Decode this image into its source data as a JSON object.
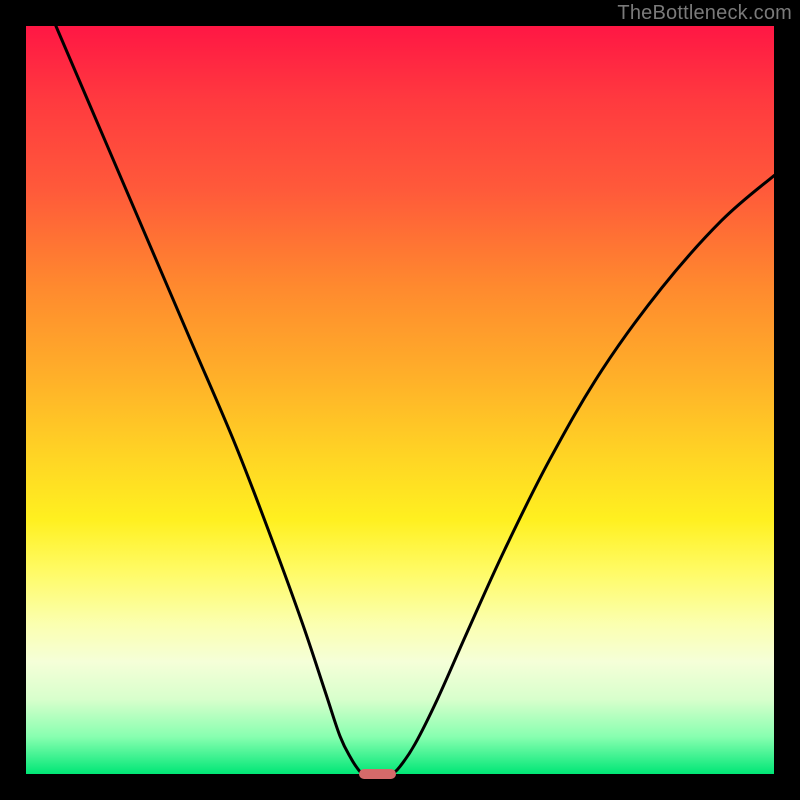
{
  "watermark": "TheBottleneck.com",
  "chart_data": {
    "type": "line",
    "title": "",
    "xlabel": "",
    "ylabel": "",
    "xlim": [
      0,
      100
    ],
    "ylim": [
      0,
      100
    ],
    "grid": false,
    "legend": false,
    "series": [
      {
        "name": "left-curve",
        "x": [
          4,
          10,
          16,
          22,
          28,
          33,
          37,
          40,
          42,
          43.5,
          44.5,
          45
        ],
        "values": [
          100,
          86,
          72,
          58,
          44,
          31,
          20,
          11,
          5,
          2,
          0.5,
          0
        ]
      },
      {
        "name": "right-curve",
        "x": [
          49,
          50,
          52,
          55,
          59,
          64,
          70,
          77,
          85,
          93,
          100
        ],
        "values": [
          0,
          1,
          4,
          10,
          19,
          30,
          42,
          54,
          65,
          74,
          80
        ]
      }
    ],
    "marker": {
      "name": "optimal-point",
      "x": 47,
      "y": 0,
      "width_pct": 5,
      "height_pct": 1.4,
      "color": "#d46a6a"
    },
    "background_gradient": {
      "top": "#ff1744",
      "mid": "#ffd624",
      "bottom": "#00e676"
    }
  }
}
